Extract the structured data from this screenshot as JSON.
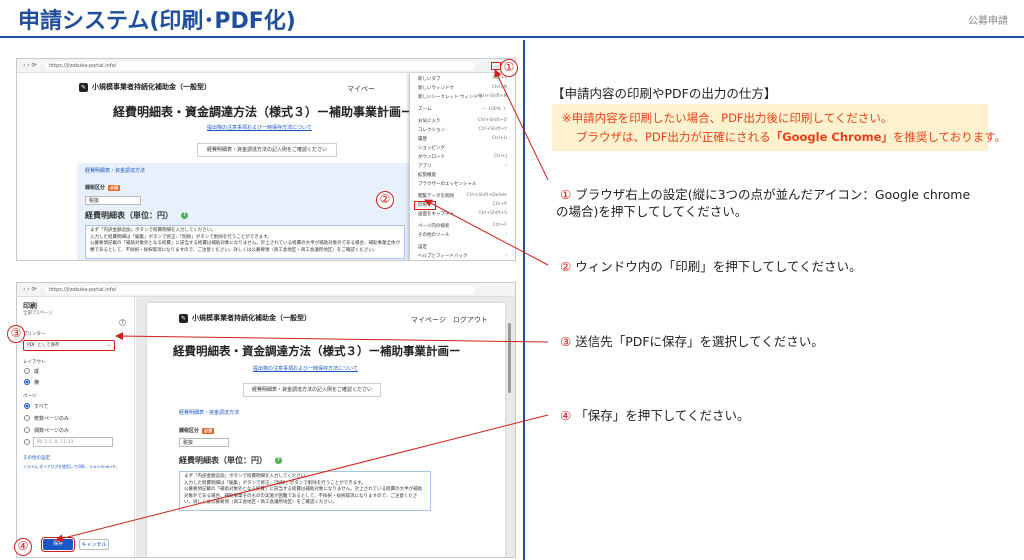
{
  "header": {
    "title": "申請システム(印刷･PDF化)",
    "corner_tag": "公募申請"
  },
  "colors": {
    "brand": "#1f4e9a",
    "accent_red": "#d0201a",
    "note_bg": "#fdf2cd",
    "note_text": "#e8401a",
    "link_blue": "#1a56c4"
  },
  "screenshot_top": {
    "site_name": "小規模事業者持続化補助金（一般型）",
    "site_nav": "マイペー",
    "page_heading": "経費明細表・資金調達方法（様式３）ー補助事業計画ー",
    "guide_link": "提出物の注意事項および一時保存方法について",
    "notice": "経費明細表・資金調達方法の記入例をご確認ください",
    "panel_link": "経費明細表・資金調達方法",
    "tax_label": "課税区分",
    "required": "必須",
    "tax_value": "税抜",
    "section_heading": "経費明細表（単位：円）",
    "info_lines": [
      "まず「内訳金額追加」ボタンで経費明細を入力してください。",
      "入力した経費明細は「編集」ボタンで修正、「削除」ボタンで削除を行うことができます。",
      "公募要領記載の「補助対象外となる経費」に該当する経費は補助対象になりません。計上されている経費の大半が補助対象外である場合、補助事業全体が",
      "類であるとして、不採択・採択取消になりますので、ご注意ください。詳しくは公募要領（商工会地区・商工会議所地区）をご確認ください。"
    ],
    "menu_items": [
      {
        "label": "新しいタブ",
        "shortcut": "Ctrl+T"
      },
      {
        "label": "新しいウィンドウ",
        "shortcut": "Ctrl+N"
      },
      {
        "label": "新しいシークレット ウィンドウ",
        "shortcut": "Ctrl+Shift+N"
      },
      {
        "label": "ズーム",
        "shortcut": "－ 100% ＋"
      },
      {
        "label": "お気に入り",
        "shortcut": "Ctrl+Shift+O"
      },
      {
        "label": "コレクション",
        "shortcut": "Ctrl+Shift+Y"
      },
      {
        "label": "履歴",
        "shortcut": "Ctrl+H"
      },
      {
        "label": "ショッピング",
        "shortcut": ""
      },
      {
        "label": "ダウンロード",
        "shortcut": "Ctrl+J"
      },
      {
        "label": "アプリ",
        "shortcut": "›"
      },
      {
        "label": "拡張機能",
        "shortcut": ""
      },
      {
        "label": "ブラウザーのエッセンシャル",
        "shortcut": ""
      },
      {
        "label": "閲覧データを削除",
        "shortcut": "Ctrl+Shift+Delete"
      },
      {
        "label": "印刷",
        "shortcut": "Ctrl+P"
      },
      {
        "label": "画面をキャプチャ",
        "shortcut": "Ctrl+Shift+S"
      },
      {
        "label": "ページ内の検索",
        "shortcut": "Ctrl+F"
      },
      {
        "label": "その他のツール",
        "shortcut": "›"
      },
      {
        "label": "設定",
        "shortcut": ""
      },
      {
        "label": "ヘルプとフィードバック",
        "shortcut": "›"
      }
    ]
  },
  "screenshot_bottom": {
    "print_title": "印刷",
    "print_pages": "全部で1ページ",
    "printer_label": "プリンター",
    "printer_value": "PDF として保存",
    "layout_label": "レイアウト",
    "layout_options": [
      "縦",
      "横"
    ],
    "pages_label": "ページ",
    "pages_options": [
      "すべて",
      "奇数ページのみ",
      "偶数ページのみ",
      "例: 1-5, 8, 11-13"
    ],
    "more_settings": "その他の設定",
    "system_dialog": "システム ダイアログを使用して印刷... (Ctrl+Shift+P)",
    "save_button": "保存",
    "cancel_button": "キャンセル",
    "site_name": "小規模事業者持続化補助金（一般型）",
    "site_nav": "マイページ　ログアウト",
    "page_heading": "経費明細表・資金調達方法（様式３）ー補助事業計画ー",
    "guide_link": "提出物の注意事項および一時保存方法について",
    "notice": "経費明細表・資金調達方法の記入例をご確認ください",
    "panel_link": "経費明細表・資金調達方法",
    "tax_label": "課税区分",
    "required": "必須",
    "tax_value": "税抜",
    "section_heading": "経費明細表（単位：円）",
    "info_lines": [
      "まず「内訳金額追加」ボタンで経費明細を入力してください。",
      "入力した経費明細は「編集」ボタンで修正、「削除」ボタンで削除を行うことができます。",
      "公募要領記載の「補助対象外となる経費」に該当する経費は補助対象になりません。計上されている経費の大半が補助",
      "対象外である場合、補助事業そのものの実施が困難であるとして、不採択・採択取消になりますので、ご注意くださ",
      "い。詳しくは公募要領（商工会地区・商工会議所地区）をご確認ください。"
    ]
  },
  "markers": [
    "①",
    "②",
    "③",
    "④"
  ],
  "right": {
    "heading": "【申請内容の印刷やPDFの出力の仕方】",
    "note_line1": "※申請内容を印刷したい場合、PDF出力後に印刷してください。",
    "note_line2_pre": "ブラウザは、PDF出力が正確にされる",
    "note_line2_bold": "「Google Chrome」",
    "note_line2_post": "を推奨しております。",
    "step1_num": "①",
    "step1_text": "ブラウザ右上の設定(縦に3つの点が並んだアイコン：Google chrome",
    "step1_text2": "の場合)を押下してしてください。",
    "step2_num": "②",
    "step2_text": "ウィンドウ内の「印刷」を押下してしてください。",
    "step3_num": "③",
    "step3_text": "送信先「PDFに保存」を選択してください。",
    "step4_num": "④",
    "step4_text": "「保存」を押下してください。"
  }
}
